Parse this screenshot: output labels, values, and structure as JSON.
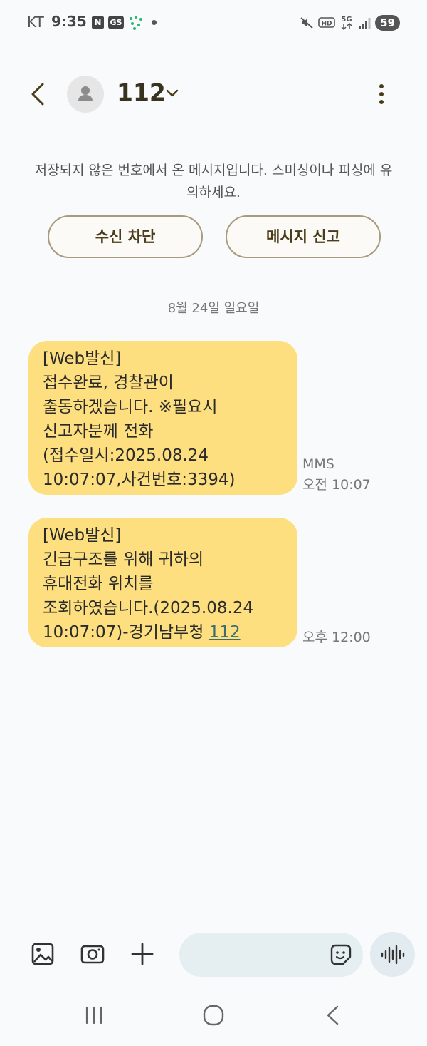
{
  "status_bar": {
    "carrier": "KT",
    "time": "9:35",
    "n_badge": "N",
    "gs_badge": "GS",
    "network_label": "5G",
    "hd_label": "HD",
    "battery": "59",
    "icons": [
      "mute-icon",
      "hd-voice-icon",
      "5g-icon",
      "signal-icon",
      "battery-icon"
    ]
  },
  "header": {
    "title": "112",
    "icons": [
      "back-arrow-icon",
      "avatar-person-icon",
      "chevron-down-icon",
      "more-vertical-icon"
    ]
  },
  "warning": {
    "text": "저장되지 않은 번호에서 온 메시지입니다. 스미싱이나 피싱에 유의하세요."
  },
  "actions": {
    "block_label": "수신 차단",
    "report_label": "메시지 신고"
  },
  "date_separator": "8월 24일 일요일",
  "messages": [
    {
      "text": "[Web발신]\n접수완료, 경찰관이\n출동하겠습니다. ※필요시\n신고자분께 전화\n(접수일시:2025.08.24\n10:07:07,사건번호:3394)",
      "type_label": "MMS",
      "time": "오전 10:07"
    },
    {
      "text": "[Web발신]\n긴급구조를 위해 귀하의\n휴대전화 위치를\n조회하였습니다.(2025.08.24\n10:07:07)-경기남부청 ",
      "link": "112",
      "time": "오후 12:00"
    }
  ],
  "composer": {
    "placeholder": "",
    "icons": [
      "gallery-icon",
      "camera-icon",
      "plus-icon",
      "sticker-icon",
      "voice-wave-icon"
    ]
  },
  "nav_bar": {
    "icons": [
      "recent-apps-icon",
      "home-icon",
      "back-nav-icon"
    ]
  },
  "colors": {
    "background": "#f9fafb",
    "bubble": "#fddf7f",
    "pill_border": "#a89a7e",
    "title": "#3a3220"
  }
}
